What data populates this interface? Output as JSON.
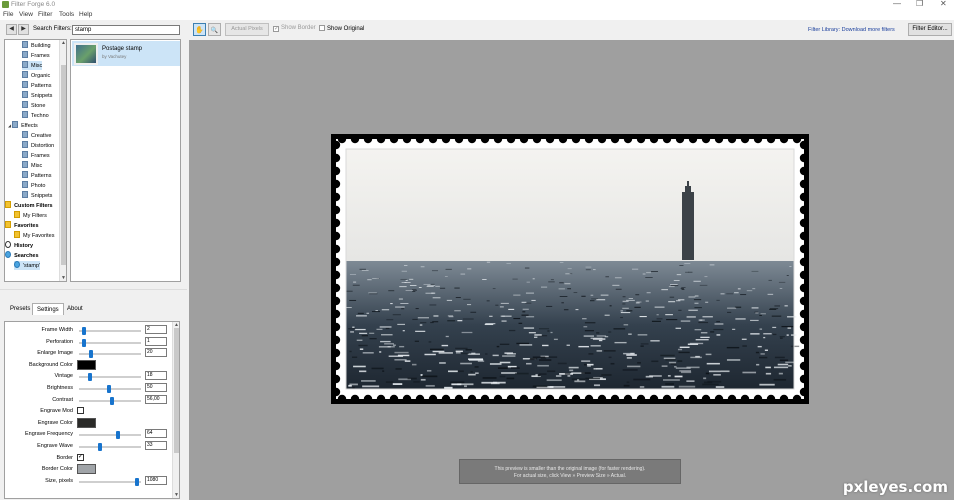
{
  "window": {
    "title": "Filter Forge 6.0",
    "controls": {
      "minimize": "—",
      "maximize": "❐",
      "close": "✕"
    }
  },
  "menu": [
    "File",
    "View",
    "Filter",
    "Tools",
    "Help"
  ],
  "search": {
    "back_icon": "◀",
    "forward_icon": "▶",
    "label": "Search Filters:",
    "value": "stamp"
  },
  "tree": [
    {
      "label": "Building",
      "indent": 1,
      "icon": "category-icon"
    },
    {
      "label": "Frames",
      "indent": 1,
      "icon": "category-icon"
    },
    {
      "label": "Misc",
      "indent": 1,
      "icon": "category-icon",
      "selected": true
    },
    {
      "label": "Organic",
      "indent": 1,
      "icon": "category-icon"
    },
    {
      "label": "Patterns",
      "indent": 1,
      "icon": "category-icon"
    },
    {
      "label": "Snippets",
      "indent": 1,
      "icon": "category-icon"
    },
    {
      "label": "Stone",
      "indent": 1,
      "icon": "category-icon"
    },
    {
      "label": "Techno",
      "indent": 1,
      "icon": "category-icon"
    },
    {
      "label": "Effects",
      "indent": 0,
      "icon": "category-icon",
      "expander": "◢"
    },
    {
      "label": "Creative",
      "indent": 1,
      "icon": "category-icon"
    },
    {
      "label": "Distortion",
      "indent": 1,
      "icon": "category-icon"
    },
    {
      "label": "Frames",
      "indent": 1,
      "icon": "category-icon"
    },
    {
      "label": "Misc",
      "indent": 1,
      "icon": "category-icon"
    },
    {
      "label": "Patterns",
      "indent": 1,
      "icon": "category-icon"
    },
    {
      "label": "Photo",
      "indent": 1,
      "icon": "category-icon"
    },
    {
      "label": "Snippets",
      "indent": 1,
      "icon": "category-icon"
    },
    {
      "label": "Custom Filters",
      "indent": -1,
      "icon": "custom-filters-icon",
      "bold": true,
      "expander": "◢"
    },
    {
      "label": "My Filters",
      "indent": 0,
      "icon": "star-icon"
    },
    {
      "label": "Favorites",
      "indent": -1,
      "icon": "star-icon",
      "bold": true,
      "expander": "◢"
    },
    {
      "label": "My Favorites",
      "indent": 0,
      "icon": "star-icon"
    },
    {
      "label": "History",
      "indent": -1,
      "icon": "history-icon",
      "bold": true,
      "expander": "▷"
    },
    {
      "label": "Searches",
      "indent": -1,
      "icon": "search-icon",
      "bold": true,
      "expander": "◢"
    },
    {
      "label": "'stamp'",
      "indent": 0,
      "icon": "search-icon",
      "selected": true
    }
  ],
  "results": [
    {
      "name": "Postage stamp",
      "author": "by Vachutey"
    }
  ],
  "tabs": [
    "Presets",
    "Settings",
    "About"
  ],
  "settings": [
    {
      "label": "Frame Width",
      "type": "slider",
      "value": "2",
      "level": 0.05
    },
    {
      "label": "Perforation",
      "type": "slider",
      "value": "1",
      "level": 0.05
    },
    {
      "label": "Enlarge Image",
      "type": "slider",
      "value": "20",
      "level": 0.18
    },
    {
      "label": "Background Color",
      "type": "color",
      "color": "#000000"
    },
    {
      "label": "Vintage",
      "type": "slider",
      "value": "18",
      "level": 0.16
    },
    {
      "label": "Brightness",
      "type": "slider",
      "value": "50",
      "level": 0.48
    },
    {
      "label": "Contrast",
      "type": "slider",
      "value": "56,00",
      "level": 0.53
    },
    {
      "label": "Engrave Mod",
      "type": "checkbox",
      "checked": false
    },
    {
      "label": "Engrave Color",
      "type": "color",
      "color": "#2a2a28"
    },
    {
      "label": "Engrave Frequency",
      "type": "slider",
      "value": "64",
      "level": 0.63
    },
    {
      "label": "Engrave Wave",
      "type": "slider",
      "value": "33",
      "level": 0.32
    },
    {
      "label": "Border",
      "type": "checkbox",
      "checked": true
    },
    {
      "label": "Border Color",
      "type": "color",
      "color": "#a0a4a8"
    },
    {
      "label": "Size, pixels",
      "type": "slider",
      "value": "1080",
      "level": 0.97
    }
  ],
  "toolbar": {
    "hand_icon": "✋",
    "zoom_icon": "🔍",
    "actual_pixels": "Actual Pixels",
    "show_border": "Show Border",
    "show_original": "Show Original",
    "library_link": "Filter Library: Download more filters",
    "editor_button": "Filter Editor..."
  },
  "preview_hint": {
    "line1": "This preview is smaller than the original image (for faster rendering).",
    "line2": "For actual size, click View » Preview Size » Actual."
  },
  "watermark": "pxleyes.com",
  "colors": {
    "accent": "#1874cd",
    "selection": "#cce4f7",
    "preview_bg": "#9f9f9f",
    "link": "#1a3e9c"
  }
}
